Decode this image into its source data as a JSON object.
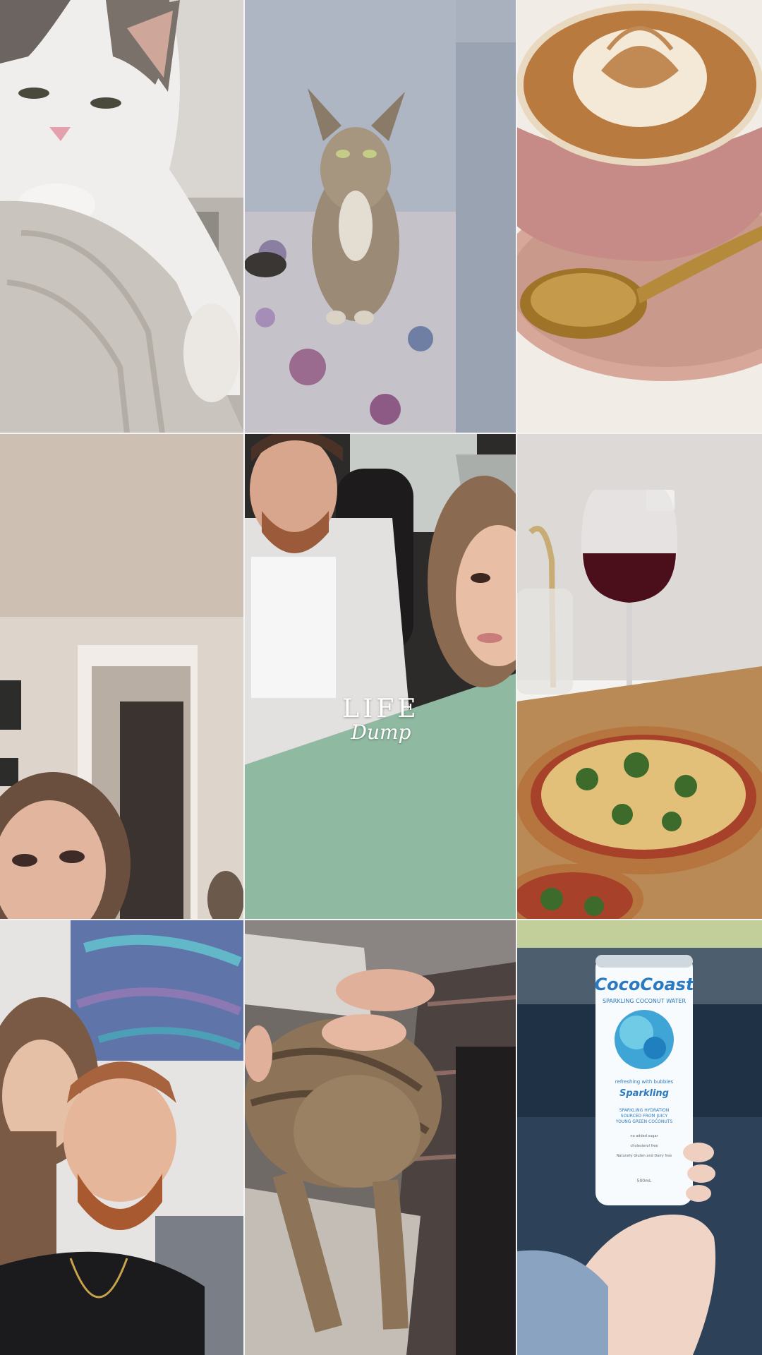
{
  "collage": {
    "title_line1": "LIFE",
    "title_line2": "Dump"
  },
  "can": {
    "brand": "CocoCoast",
    "subtitle": "SPARKLING COCONUT WATER",
    "tagline": "refreshing with bubbles",
    "flavor": "Sparkling",
    "line1": "SPARKLING HYDRATION",
    "line2": "SOURCED FROM JUICY",
    "line3": "YOUNG GREEN COCONUTS",
    "claim1": "no added sugar",
    "claim2": "cholesterol free",
    "claim3": "Naturally Gluten and Dairy free",
    "volume": "500mL"
  },
  "photos": [
    {
      "subject": "white-and-grey-cat-closeup"
    },
    {
      "subject": "tabby-cat-on-rug"
    },
    {
      "subject": "latte-art-coffee"
    },
    {
      "subject": "woman-selfie-in-hallway"
    },
    {
      "subject": "couple-selfie-in-car"
    },
    {
      "subject": "red-wine-and-pizza"
    },
    {
      "subject": "couple-portrait-with-painting"
    },
    {
      "subject": "tabby-cat-sleeping-on-lap"
    },
    {
      "subject": "coconut-water-can-in-hand"
    }
  ]
}
